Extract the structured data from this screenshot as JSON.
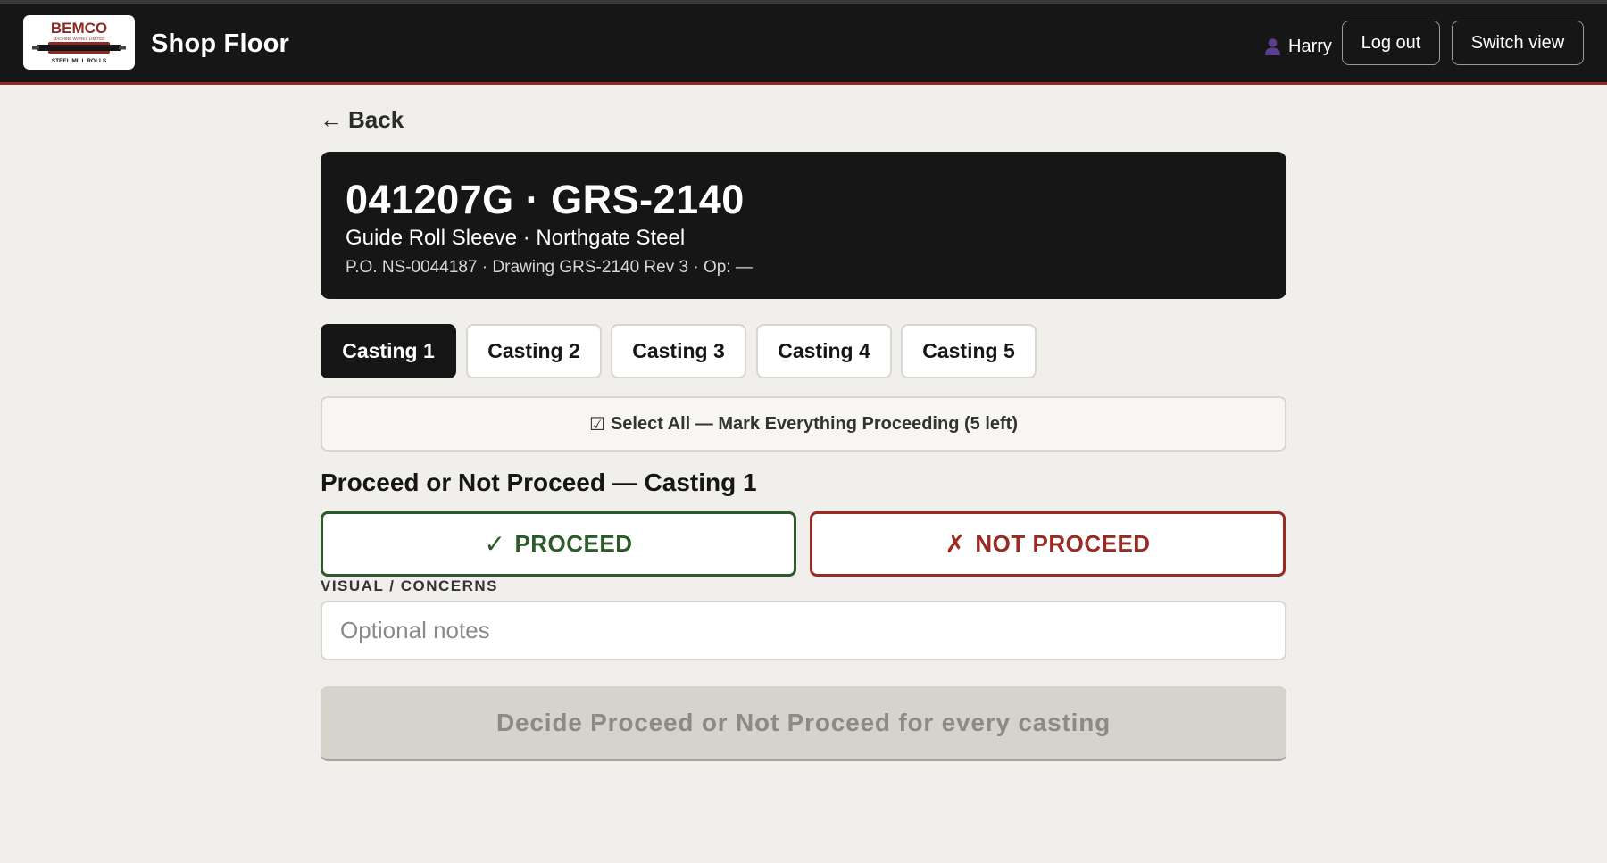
{
  "header": {
    "logo": {
      "brand": "BEMCO",
      "tagline": "MACHINE WORKS LIMITED",
      "subtitle": "STEEL MILL ROLLS",
      "colors": {
        "brand": "#8d2a24",
        "roll": "#161616"
      }
    },
    "app_title": "Shop Floor",
    "user_name": "Harry",
    "user_icon": "person-icon",
    "logout_label": "Log out",
    "switch_view_label": "Switch view"
  },
  "nav": {
    "back_arrow": "←",
    "back_label": "Back"
  },
  "job": {
    "title": "041207G · GRS-2140",
    "subtitle": "Guide Roll Sleeve · Northgate Steel",
    "meta": "P.O. NS-0044187 · Drawing GRS-2140 Rev 3 · Op: —"
  },
  "castings": {
    "tabs": [
      {
        "label": "Casting 1",
        "active": true
      },
      {
        "label": "Casting 2",
        "active": false
      },
      {
        "label": "Casting 3",
        "active": false
      },
      {
        "label": "Casting 4",
        "active": false
      },
      {
        "label": "Casting 5",
        "active": false
      }
    ],
    "select_all_icon": "☑",
    "select_all_label": "Select All — Mark Everything Proceeding (5 left)"
  },
  "decision": {
    "section_title": "Proceed or Not Proceed — Casting 1",
    "proceed_mark": "✓",
    "proceed_label": "PROCEED",
    "not_proceed_mark": "✗",
    "not_proceed_label": "NOT PROCEED",
    "colors": {
      "proceed": "#2d5a2a",
      "not_proceed": "#9a2a24"
    }
  },
  "notes": {
    "label": "VISUAL / CONCERNS",
    "value": "",
    "placeholder": "Optional notes"
  },
  "submit": {
    "label": "Decide Proceed or Not Proceed for every casting",
    "disabled": true
  }
}
